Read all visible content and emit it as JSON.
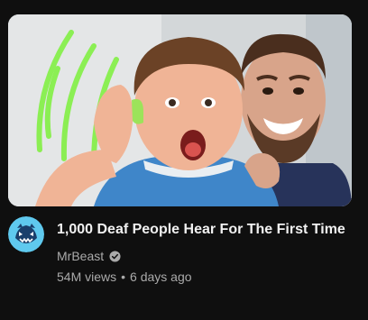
{
  "video": {
    "title": "1,000 Deaf People Hear For The First Time",
    "channel": "MrBeast",
    "views": "54M views",
    "separator": "•",
    "age": "6 days ago"
  },
  "icons": {
    "avatar": "mrbeast-logo-icon",
    "verified": "verified-check-icon"
  },
  "colors": {
    "background": "#0f0f0f",
    "title": "#f1f1f1",
    "secondary": "#aaaaaa",
    "sound_waves": "#7cf03a"
  }
}
